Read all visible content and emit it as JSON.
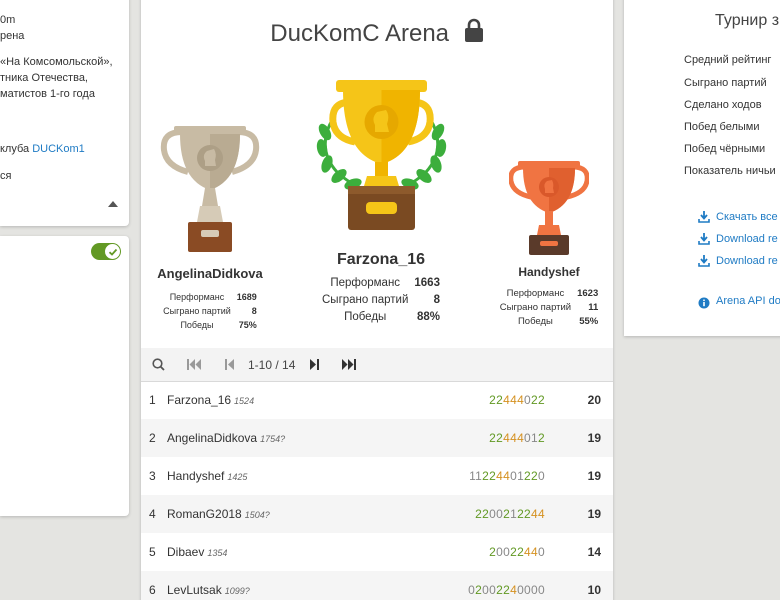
{
  "left_panel": {
    "lines": [
      "0m",
      "рена",
      "«На Комсомольской»,",
      "тника Отечества,",
      "матистов 1-го года"
    ],
    "club_prefix": "клуба ",
    "club_link": "DUCKom1",
    "line_last": "ся"
  },
  "tournament": {
    "title": "DucKomC Arena",
    "icons": {
      "lock": "lock-icon"
    }
  },
  "podium": {
    "stat_labels": {
      "performance": "Перформанс",
      "games": "Сыграно партий",
      "wins": "Победы"
    },
    "first": {
      "name": "Farzona_16",
      "performance": "1663",
      "games": "8",
      "wins": "88%"
    },
    "second": {
      "name": "AngelinaDidkova",
      "performance": "1689",
      "games": "8",
      "wins": "75%"
    },
    "third": {
      "name": "Handyshef",
      "performance": "1623",
      "games": "11",
      "wins": "55%"
    }
  },
  "pager": {
    "text": "1-10 / 14"
  },
  "standings": [
    {
      "rank": "1",
      "name": "Farzona_16",
      "rating": "1524",
      "sheet": "22444022",
      "score": "20"
    },
    {
      "rank": "2",
      "name": "AngelinaDidkova",
      "rating": "1754?",
      "sheet": "22444012",
      "score": "19"
    },
    {
      "rank": "3",
      "name": "Handyshef",
      "rating": "1425",
      "sheet": "11224401220",
      "score": "19"
    },
    {
      "rank": "4",
      "name": "RomanG2018",
      "rating": "1504?",
      "sheet": "2200212244",
      "score": "19"
    },
    {
      "rank": "5",
      "name": "Dibaev",
      "rating": "1354",
      "sheet": "20022440",
      "score": "14"
    },
    {
      "rank": "6",
      "name": "LevLutsak",
      "rating": "1099?",
      "sheet": "02002240000",
      "score": "10"
    }
  ],
  "right_panel": {
    "title": "Турнир з",
    "stats": [
      "Средний рейтинг",
      "Сыграно партий",
      "Сделано ходов",
      "Побед белыми",
      "Побед чёрными",
      "Показатель ничьи"
    ],
    "links": [
      "Скачать все",
      "Download re",
      "Download re"
    ],
    "api_link": "Arena API do"
  },
  "colors": {
    "accent": "#1f7bc4",
    "toggle_on": "#629924",
    "score_green": "#629924",
    "score_orange": "#d59120",
    "score_grey": "#888888",
    "gold": "#f5c518",
    "silver": "#c8bba4",
    "bronze": "#f07442"
  }
}
